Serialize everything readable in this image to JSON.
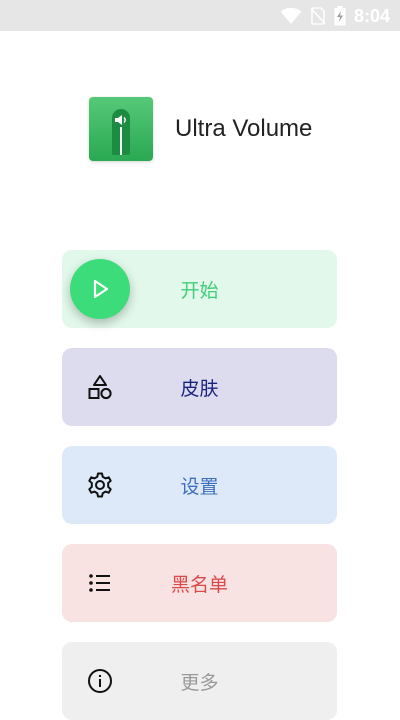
{
  "status_bar": {
    "time": "8:04",
    "icons": [
      "wifi-icon",
      "no-sim-icon",
      "battery-charging-icon"
    ]
  },
  "app": {
    "title": "Ultra Volume",
    "icon": "ultra-volume-app-icon"
  },
  "menu": [
    {
      "id": "start",
      "label": "开始",
      "icon": "play-icon",
      "bg": "#e2f8ea",
      "color": "#3fcf78"
    },
    {
      "id": "skins",
      "label": "皮肤",
      "icon": "shapes-icon",
      "bg": "#dcdcee",
      "color": "#1a237e"
    },
    {
      "id": "settings",
      "label": "设置",
      "icon": "gear-icon",
      "bg": "#dde9f8",
      "color": "#3e6fbf"
    },
    {
      "id": "blacklist",
      "label": "黑名单",
      "icon": "list-icon",
      "bg": "#f8e2e2",
      "color": "#d94a4a"
    },
    {
      "id": "more",
      "label": "更多",
      "icon": "info-icon",
      "bg": "#efefef",
      "color": "#999999"
    }
  ]
}
